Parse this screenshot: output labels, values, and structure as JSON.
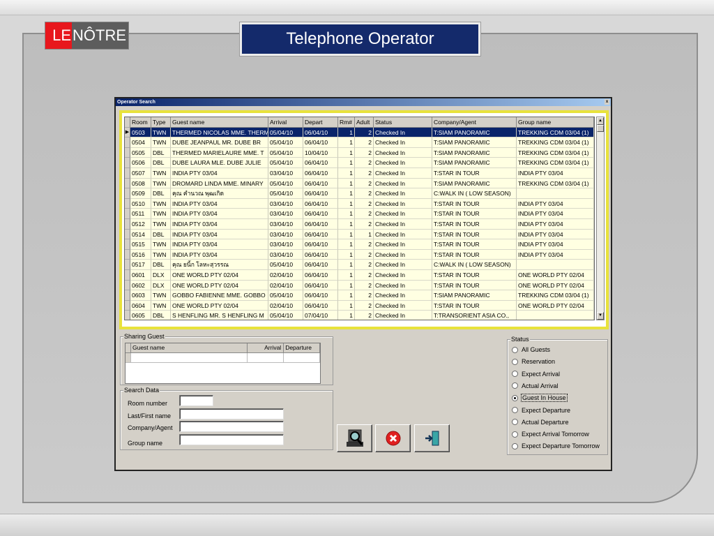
{
  "brand": {
    "logo_left": "LE",
    "logo_right": "NÔTRE"
  },
  "slide_title": "Telephone Operator",
  "window": {
    "title": "Operator Search",
    "close": "x"
  },
  "grid": {
    "columns": [
      "Room",
      "Type",
      "Guest name",
      "Arrival",
      "Depart",
      "Rm#",
      "Adult",
      "Status",
      "Company/Agent",
      "Group name"
    ],
    "selected_row": 0,
    "rows": [
      [
        "0503",
        "TWN",
        "THERMED NICOLAS MME. THERMED",
        "05/04/10",
        "06/04/10",
        "1",
        "2",
        "Checked In",
        "T:SIAM PANORAMIC",
        "TREKKING CDM 03/04 (1)"
      ],
      [
        "0504",
        "TWN",
        "DUBE JEANPAUL MR. DUBE BR",
        "05/04/10",
        "06/04/10",
        "1",
        "2",
        "Checked In",
        "T:SIAM PANORAMIC",
        "TREKKING CDM 03/04 (1)"
      ],
      [
        "0505",
        "DBL",
        "THERMED MARIELAURE MME. T",
        "05/04/10",
        "10/04/10",
        "1",
        "2",
        "Checked In",
        "T:SIAM PANORAMIC",
        "TREKKING CDM 03/04 (1)"
      ],
      [
        "0506",
        "DBL",
        "DUBE LAURA MLE. DUBE JULIE",
        "05/04/10",
        "06/04/10",
        "1",
        "2",
        "Checked In",
        "T:SIAM PANORAMIC",
        "TREKKING CDM 03/04 (1)"
      ],
      [
        "0507",
        "TWN",
        "INDIA PTY 03/04",
        "03/04/10",
        "06/04/10",
        "1",
        "2",
        "Checked In",
        "T:STAR IN TOUR",
        "INDIA PTY 03/04"
      ],
      [
        "0508",
        "TWN",
        "DROMARD LINDA MME. MINARY",
        "05/04/10",
        "06/04/10",
        "1",
        "2",
        "Checked In",
        "T:SIAM PANORAMIC",
        "TREKKING CDM 03/04 (1)"
      ],
      [
        "0509",
        "DBL",
        "คุณ คำนวณ พุฒเกิด",
        "05/04/10",
        "06/04/10",
        "1",
        "2",
        "Checked In",
        "C:WALK IN ( LOW SEASON)",
        ""
      ],
      [
        "0510",
        "TWN",
        "INDIA PTY 03/04",
        "03/04/10",
        "06/04/10",
        "1",
        "2",
        "Checked In",
        "T:STAR IN TOUR",
        "INDIA PTY 03/04"
      ],
      [
        "0511",
        "TWN",
        "INDIA PTY 03/04",
        "03/04/10",
        "06/04/10",
        "1",
        "2",
        "Checked In",
        "T:STAR IN TOUR",
        "INDIA PTY 03/04"
      ],
      [
        "0512",
        "TWN",
        "INDIA PTY 03/04",
        "03/04/10",
        "06/04/10",
        "1",
        "2",
        "Checked In",
        "T:STAR IN TOUR",
        "INDIA PTY 03/04"
      ],
      [
        "0514",
        "DBL",
        "INDIA PTY 03/04",
        "03/04/10",
        "06/04/10",
        "1",
        "1",
        "Checked In",
        "T:STAR IN TOUR",
        "INDIA PTY 03/04"
      ],
      [
        "0515",
        "TWN",
        "INDIA PTY 03/04",
        "03/04/10",
        "06/04/10",
        "1",
        "2",
        "Checked In",
        "T:STAR IN TOUR",
        "INDIA PTY 03/04"
      ],
      [
        "0516",
        "TWN",
        "INDIA PTY 03/04",
        "03/04/10",
        "06/04/10",
        "1",
        "2",
        "Checked In",
        "T:STAR IN TOUR",
        "INDIA PTY 03/04"
      ],
      [
        "0517",
        "DBL",
        "คุณ ยนิ้ก โลหะสุวรรณ",
        "05/04/10",
        "06/04/10",
        "1",
        "2",
        "Checked In",
        "C:WALK IN ( LOW SEASON)",
        ""
      ],
      [
        "0601",
        "DLX",
        "ONE WORLD PTY 02/04",
        "02/04/10",
        "06/04/10",
        "1",
        "2",
        "Checked In",
        "T:STAR IN TOUR",
        "ONE WORLD PTY 02/04"
      ],
      [
        "0602",
        "DLX",
        "ONE WORLD PTY 02/04",
        "02/04/10",
        "06/04/10",
        "1",
        "2",
        "Checked In",
        "T:STAR IN TOUR",
        "ONE WORLD PTY 02/04"
      ],
      [
        "0603",
        "TWN",
        "GOBBO FABIENNE MME. GOBBO",
        "05/04/10",
        "06/04/10",
        "1",
        "2",
        "Checked In",
        "T:SIAM PANORAMIC",
        "TREKKING CDM 03/04 (1)"
      ],
      [
        "0604",
        "TWN",
        "ONE WORLD PTY 02/04",
        "02/04/10",
        "06/04/10",
        "1",
        "2",
        "Checked In",
        "T:STAR IN TOUR",
        "ONE WORLD PTY 02/04"
      ],
      [
        "0605",
        "DBL",
        "S HENFLING MR. S HENFLING M",
        "05/04/10",
        "07/04/10",
        "1",
        "2",
        "Checked In",
        "T:TRANSORIENT ASIA CO.,",
        ""
      ]
    ]
  },
  "sharing_guest": {
    "label": "Sharing Guest",
    "columns": [
      "Guest name",
      "Arrival",
      "Departure"
    ]
  },
  "search_data": {
    "label": "Search Data",
    "fields": [
      {
        "label": "Room number",
        "value": ""
      },
      {
        "label": "Last/First name",
        "value": ""
      },
      {
        "label": "Company/Agent",
        "value": ""
      },
      {
        "label": "Group name",
        "value": ""
      }
    ]
  },
  "status": {
    "label": "Status",
    "selected": 4,
    "options": [
      "All Guests",
      "Reservation",
      "Expect Arrival",
      "Actual Arrival",
      "Guest In House",
      "Expect Departure",
      "Actual Departure",
      "Expect Arrival Tomorrow",
      "Expect Departure Tomorrow"
    ]
  },
  "buttons": {
    "search_icon": "search-icon",
    "cancel_icon": "cancel-icon",
    "exit_icon": "exit-icon"
  },
  "colors": {
    "title_bg": "#142a6b",
    "grid_border": "#e8e23c",
    "row_bg": "#ffffe2",
    "selected_row": "#0a246a",
    "logo_red": "#e8171d"
  }
}
